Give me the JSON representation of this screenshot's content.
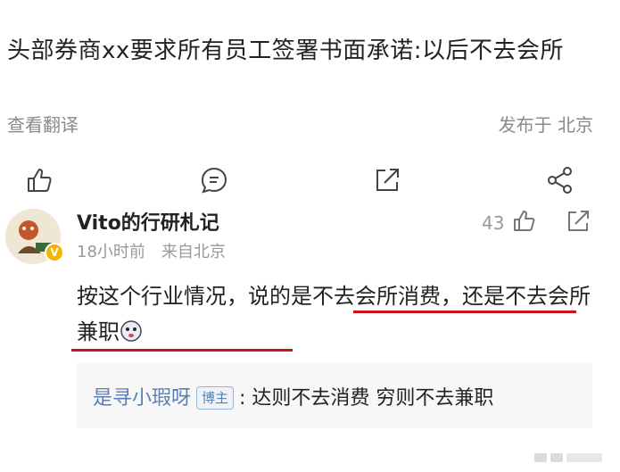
{
  "post": {
    "title": "头部券商xx要求所有员工签署书面承诺:以后不去会所",
    "translate_label": "查看翻译",
    "published_label": "发布于 北京"
  },
  "actions": {
    "like_icon": "thumbs-up-icon",
    "comment_icon": "comment-icon",
    "repost_icon": "repost-icon",
    "share_icon": "share-icon"
  },
  "comment": {
    "username": "Vito的行研札记",
    "time": "18小时前",
    "location": "来自北京",
    "like_count": "43",
    "body": "按这个行业情况，说的是不去会所消费，还是不去会所兼职",
    "reply": {
      "user": "是寻小瑕呀",
      "badge": "博主",
      "text": ": 达则不去消费 穷则不去兼职"
    }
  },
  "colors": {
    "underline": "#d0131b",
    "link": "#5a7fb4",
    "verified": "#f5b400"
  }
}
